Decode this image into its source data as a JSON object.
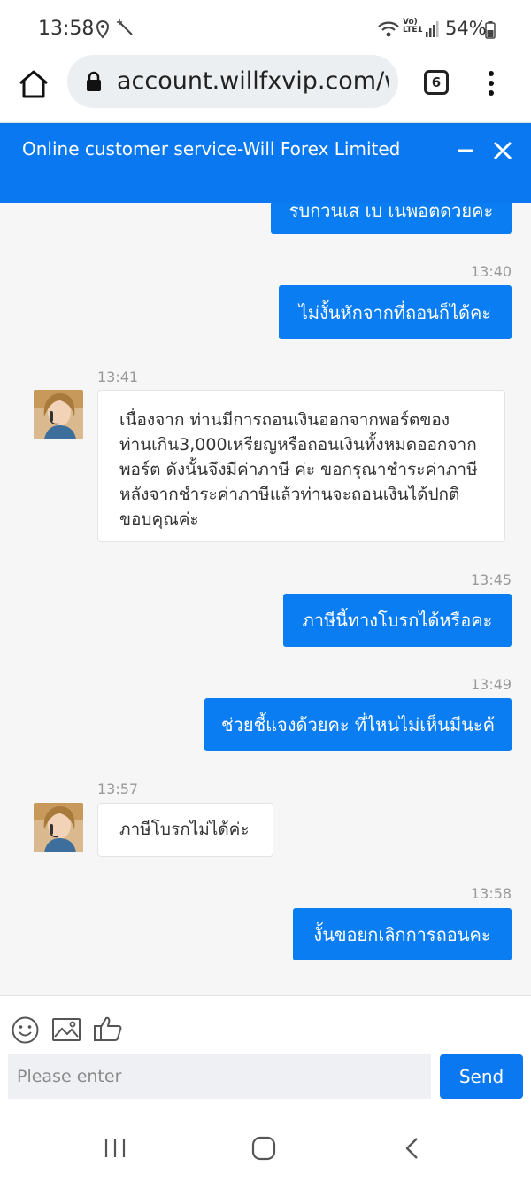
{
  "status_bar": {
    "time": "13:58",
    "lte_label_top": "Vo)",
    "lte_label_bottom": "LTE1",
    "battery": "54%"
  },
  "browser": {
    "url": "account.willfxvip.com/wi",
    "tab_count": "6"
  },
  "header": {
    "title": "Online customer service-Will Forex Limited"
  },
  "messages": {
    "m0": {
      "text": "รบกวนเส เบ เนพอตดวยคะ"
    },
    "m1": {
      "time": "13:40",
      "text": "ไม่งั้นหักจากที่ถอนก็ได้คะ"
    },
    "m2": {
      "time": "13:41",
      "lines": [
        "เนื่องจาก ท่านมีการถอนเงินออกจากพอร์ตของ",
        "ท่านเกิน3,000เหรียญหรือถอนเงินทั้งหมดออกจาก",
        "พอร์ต ดังนั้นจึงมีค่าภาษี ค่ะ ขอกรุณาชำระค่าภาษี",
        "หลังจากชำระค่าภาษีแล้วท่านจะถอนเงินได้ปกติ",
        "ขอบคุณค่ะ"
      ]
    },
    "m3": {
      "time": "13:45",
      "text": "ภาษีนี้ทางโบรกได้หรือคะ"
    },
    "m4": {
      "time": "13:49",
      "text": "ช่วยชี้แจงด้วยคะ ที่ไหนไม่เห็นมีนะค้"
    },
    "m5": {
      "time": "13:57",
      "text": "ภาษีโบรกไม่ได้ค่ะ"
    },
    "m6": {
      "time": "13:58",
      "text": "งั้นขอยกเลิกการถอนคะ"
    }
  },
  "composer": {
    "placeholder": "Please enter",
    "send_label": "Send"
  },
  "colors": {
    "brand_blue": "#0a78f0",
    "chat_bg": "#f6f6f7"
  },
  "icons": [
    "home-icon",
    "lock-icon",
    "tabs-icon",
    "menu-icon",
    "minimize-icon",
    "close-icon",
    "emoji-icon",
    "image-icon",
    "thumbs-up-icon",
    "nav-recents-icon",
    "nav-home-icon",
    "nav-back-icon"
  ]
}
